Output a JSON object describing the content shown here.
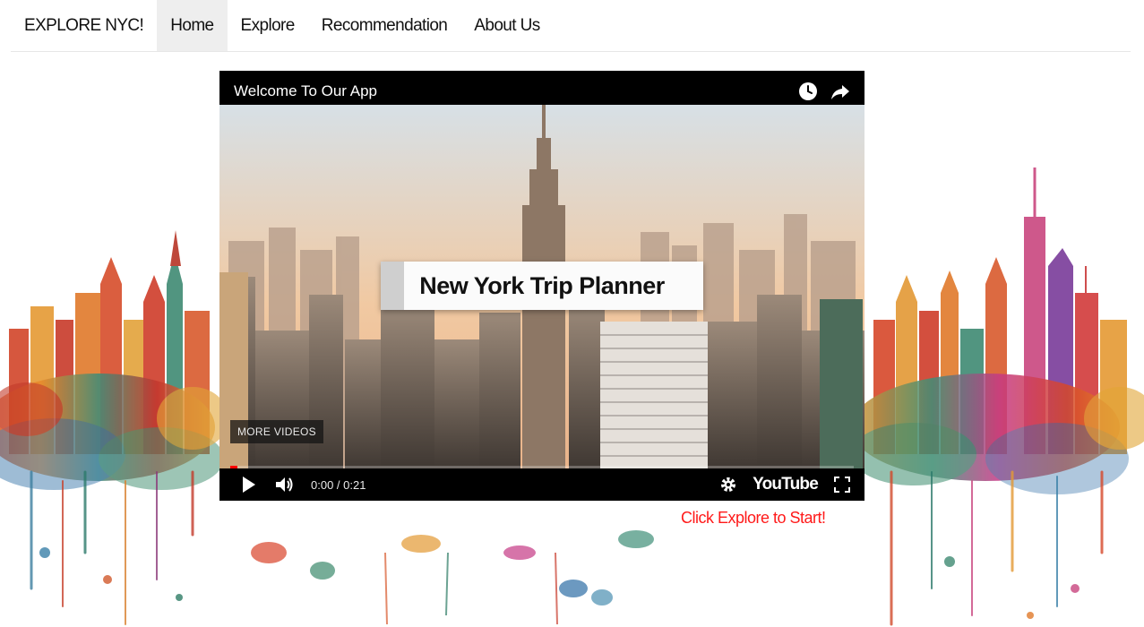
{
  "navbar": {
    "brand": "EXPLORE NYC!",
    "items": [
      {
        "label": "Home",
        "active": true
      },
      {
        "label": "Explore",
        "active": false
      },
      {
        "label": "Recommendation",
        "active": false
      },
      {
        "label": "About Us",
        "active": false
      }
    ]
  },
  "video": {
    "title": "Welcome To Our App",
    "card_text": "New York Trip Planner",
    "more_videos": "MORE VIDEOS",
    "time": "0:00 / 0:21",
    "progress": 0.012,
    "logo_text": "YouTube",
    "icons": {
      "watch_later": "clock-icon",
      "share": "share-icon",
      "play": "play-icon",
      "volume": "volume-icon",
      "settings": "gear-icon",
      "fullscreen": "fullscreen-icon"
    }
  },
  "cta": {
    "text": "Click Explore to Start!",
    "color": "#ff1a1a"
  },
  "colors": {
    "nav_active_bg": "#eeeeee",
    "video_bg": "#000000",
    "progress": "#ff0000"
  }
}
